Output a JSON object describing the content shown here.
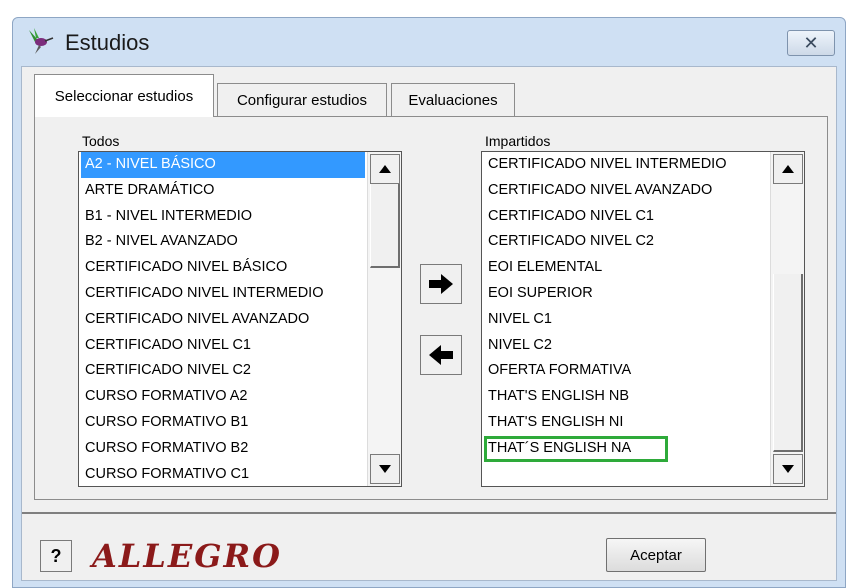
{
  "window": {
    "title": "Estudios",
    "close_glyph": "✕"
  },
  "tabs": [
    {
      "label": "Seleccionar estudios",
      "active": true
    },
    {
      "label": "Configurar estudios",
      "active": false
    },
    {
      "label": "Evaluaciones",
      "active": false
    }
  ],
  "todos": {
    "label": "Todos",
    "items": [
      "A2 - NIVEL BÁSICO",
      "ARTE DRAMÁTICO",
      "B1 - NIVEL  INTERMEDIO",
      "B2 - NIVEL AVANZADO",
      "CERTIFICADO NIVEL   BÁSICO",
      "CERTIFICADO NIVEL  INTERMEDIO",
      "CERTIFICADO NIVEL AVANZADO",
      "CERTIFICADO NIVEL C1",
      "CERTIFICADO NIVEL C2",
      "CURSO FORMATIVO A2",
      "CURSO FORMATIVO B1",
      "CURSO FORMATIVO B2",
      "CURSO FORMATIVO C1"
    ],
    "selected_index": 0
  },
  "impartidos": {
    "label": "Impartidos",
    "items": [
      "CERTIFICADO NIVEL  INTERMEDIO",
      "CERTIFICADO NIVEL AVANZADO",
      "CERTIFICADO NIVEL C1",
      "CERTIFICADO NIVEL C2",
      "EOI ELEMENTAL",
      "EOI SUPERIOR",
      "NIVEL C1",
      "NIVEL C2",
      "OFERTA FORMATIVA",
      "THAT'S ENGLISH NB",
      "THAT'S ENGLISH NI",
      "THAT´S ENGLISH NA"
    ],
    "highlighted_index": 11
  },
  "buttons": {
    "add_icon": "right-arrow-icon",
    "remove_icon": "left-arrow-icon",
    "help_label": "?",
    "ok_label": "Aceptar"
  },
  "logo": {
    "text": "ALLEGRO"
  },
  "colors": {
    "selection": "#3399ff",
    "highlight_box": "#2eaa3a"
  }
}
